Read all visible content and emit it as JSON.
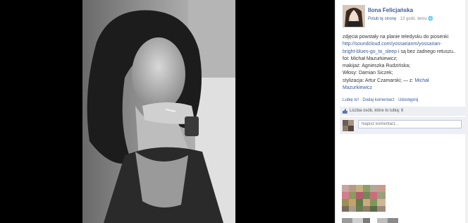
{
  "author": {
    "name": "Ilona Felicjańska",
    "like_page": "Polub tę stronę",
    "separator": " · ",
    "time": "13 godz. temu"
  },
  "caption": {
    "line1": "zdjęcia powstały na planie teledysku do piosenki",
    "link_line1": "http://soundcloud.com/yossarianm/yossarian-",
    "link_line2": "bright-blues-go_to_sleep",
    "line3_tail": " i są bez żadnego retuszu..",
    "photo_credit": "fot: Michał Mazurkiewicz;",
    "makeup": "makijaż: Agnieszka Rudzińska;",
    "hair": "Włosy: Damian Siczek;",
    "styling": "stylizacja: Artur Czamarski;",
    "via": " — z: ",
    "tagged_first": "Michał",
    "tagged_last": "Mazurkiewicz"
  },
  "actions": {
    "like": "Lubię to!",
    "comment": "Dodaj komentarz",
    "share": "Udostępnij",
    "dot": " · "
  },
  "likes": {
    "label": "Liczba osób, które to lubią: ",
    "count": "6"
  },
  "comment": {
    "placeholder": "Napisz komentarz..."
  }
}
